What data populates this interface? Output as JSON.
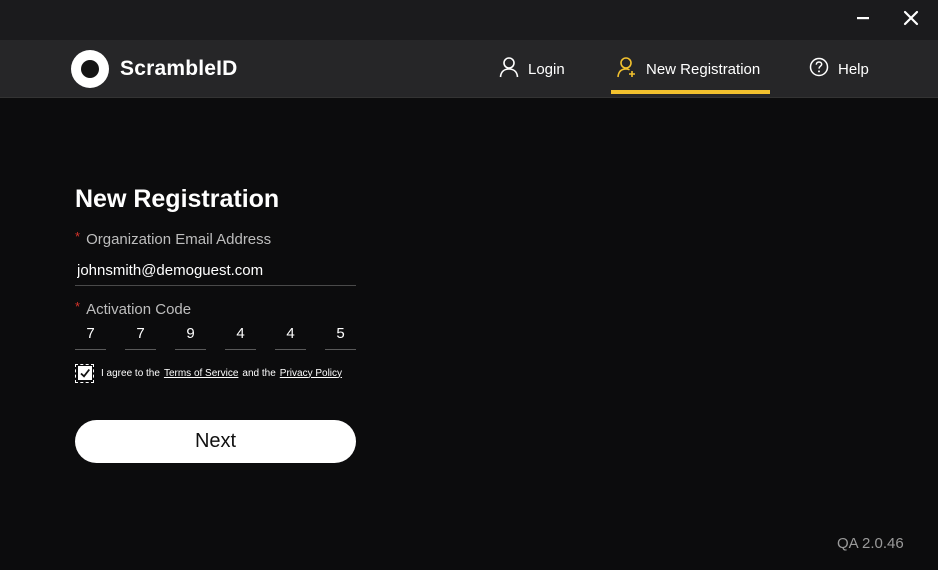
{
  "window": {
    "minimize_icon": "minimize-icon",
    "close_icon": "close-icon"
  },
  "brand": {
    "name": "ScrambleID"
  },
  "nav": {
    "login_label": "Login",
    "registration_label": "New Registration",
    "help_label": "Help",
    "active_tab": "New Registration",
    "accent_color": "#f2c12e"
  },
  "form": {
    "title": "New Registration",
    "email_label": "Organization Email Address",
    "email_value": "johnsmith@demoguest.com",
    "required_marker": "*",
    "code_label": "Activation Code",
    "code_digits": [
      "7",
      "7",
      "9",
      "4",
      "4",
      "5"
    ],
    "agree_checked": true,
    "agree_prefix": "I agree to the",
    "terms_link": "Terms of Service",
    "agree_middle": "and the",
    "privacy_link": "Privacy Policy",
    "next_label": "Next"
  },
  "footer": {
    "version": "QA 2.0.46"
  }
}
